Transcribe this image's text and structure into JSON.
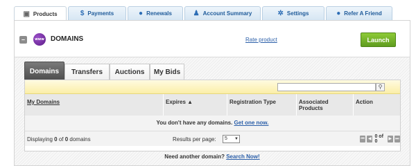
{
  "top_tabs": [
    {
      "label": "Products",
      "icon": "box-icon",
      "glyph": "▣"
    },
    {
      "label": "Payments",
      "icon": "dollar-icon",
      "glyph": "$"
    },
    {
      "label": "Renewals",
      "icon": "alert-icon",
      "glyph": "●"
    },
    {
      "label": "Account Summary",
      "icon": "user-icon",
      "glyph": "♟"
    },
    {
      "label": "Settings",
      "icon": "gear-icon",
      "glyph": "✲"
    },
    {
      "label": "Refer A Friend",
      "icon": "speech-bubble-icon",
      "glyph": "●"
    }
  ],
  "header": {
    "collapse_glyph": "–",
    "logo_text": "www",
    "title": "DOMAINS",
    "rate_link": "Rate product",
    "launch_label": "Launch"
  },
  "inner_tabs": [
    "Domains",
    "Transfers",
    "Auctions",
    "My Bids"
  ],
  "search": {
    "placeholder": "",
    "button_glyph": "⚲"
  },
  "table": {
    "columns": [
      "My Domains",
      "Expires ▲",
      "Registration Type",
      "Associated Products",
      "Action"
    ],
    "empty_message": "You don't have any domains.",
    "empty_link": "Get one now."
  },
  "footer": {
    "displaying_prefix": "Displaying ",
    "displaying_count": "0",
    "displaying_mid": " of ",
    "displaying_total": "0",
    "displaying_suffix": " domains",
    "rpp_label": "Results per page:",
    "rpp_value": "5",
    "page_text": "0 of 0"
  },
  "bottom": {
    "text": "Need another domain?",
    "link": "Search Now!"
  },
  "colors": {
    "launch": "#6fad27",
    "active_tab": "#5a5a5a",
    "link": "#2a5ea8",
    "search_strip": "#fbeea7"
  }
}
